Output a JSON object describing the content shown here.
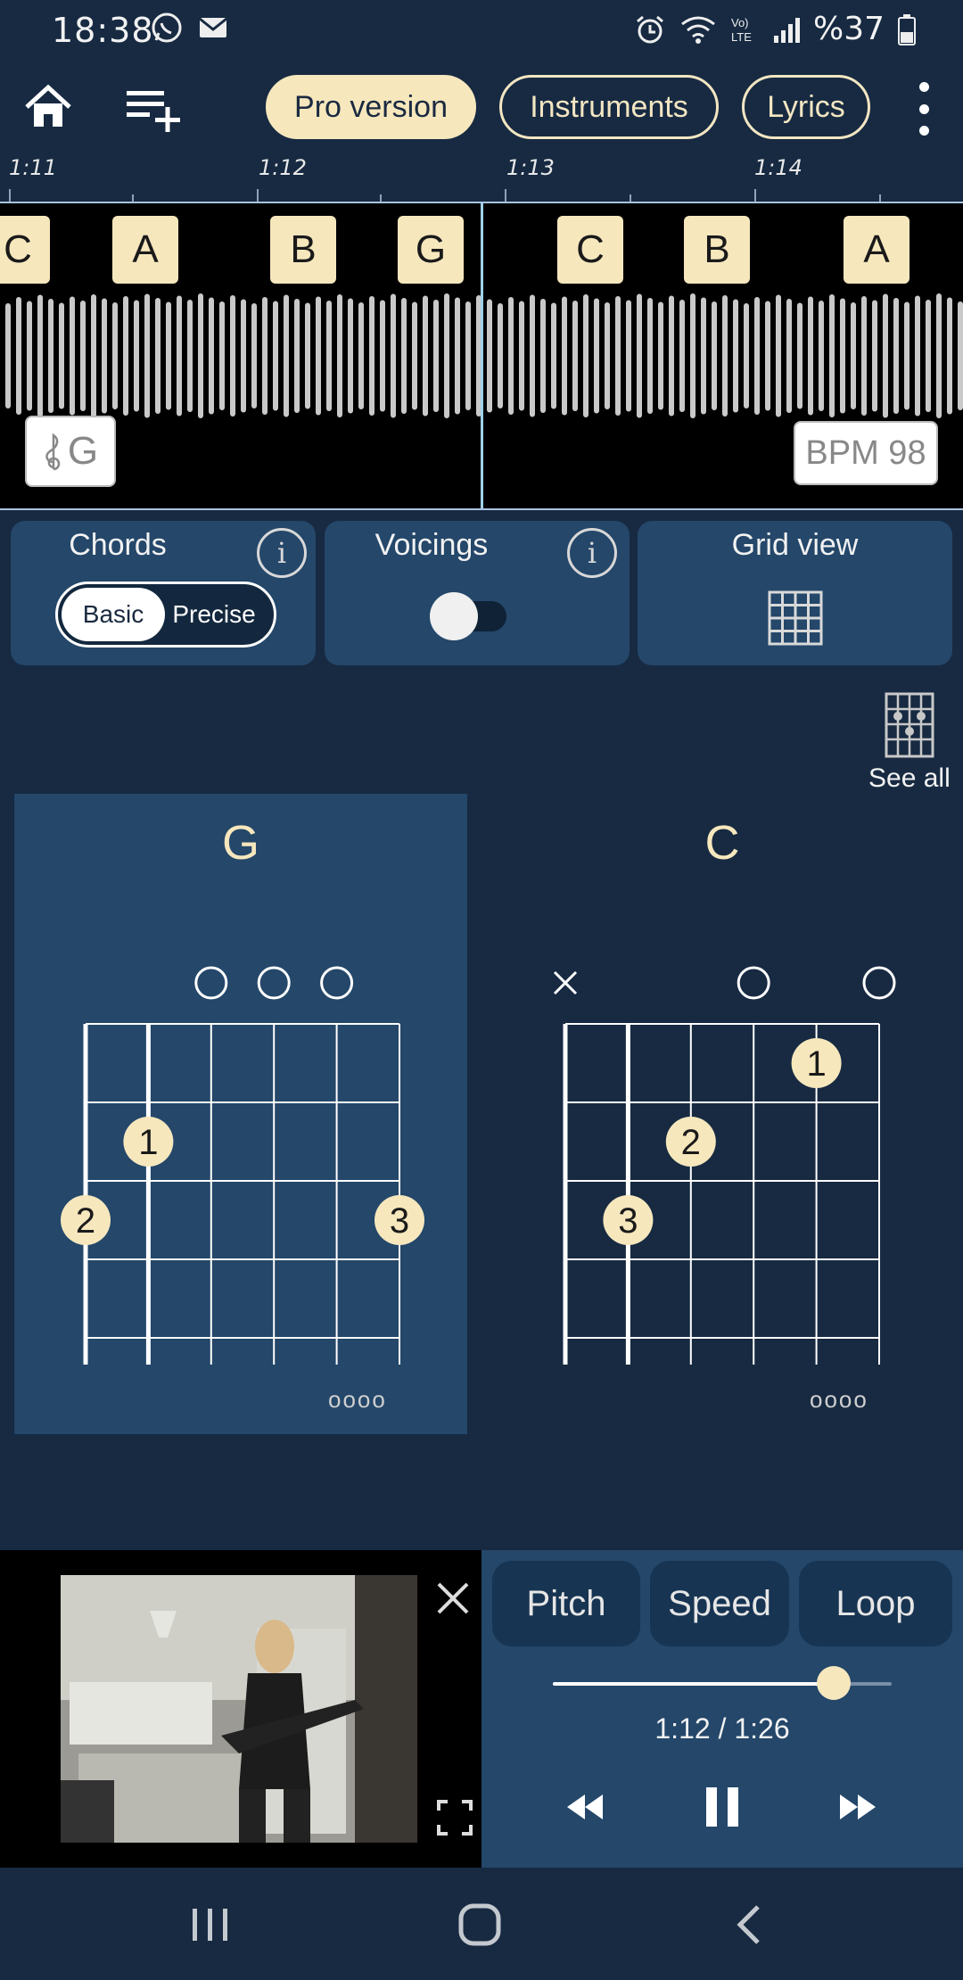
{
  "status_bar": {
    "time": "18:38",
    "battery": "%37"
  },
  "toolbar": {
    "pro_label": "Pro version",
    "instruments_label": "Instruments",
    "lyrics_label": "Lyrics"
  },
  "timeline": {
    "ticks": [
      "1:11",
      "1:12",
      "1:13",
      "1:14"
    ]
  },
  "waveform": {
    "chords": [
      "C",
      "A",
      "B",
      "G",
      "C",
      "B",
      "A"
    ],
    "key": "G",
    "bpm": "BPM 98"
  },
  "controls": {
    "chords_title": "Chords",
    "mode_basic": "Basic",
    "mode_precise": "Precise",
    "voicings_title": "Voicings",
    "voicings_on": false,
    "grid_title": "Grid view",
    "info_glyph": "i"
  },
  "see_all_label": "See all",
  "chord_diagrams": [
    {
      "name": "G",
      "open_strings": [
        "",
        "",
        "o",
        "o",
        "o",
        ""
      ],
      "fingers": [
        {
          "string": 2,
          "fret": 2,
          "finger": "1"
        },
        {
          "string": 1,
          "fret": 3,
          "finger": "2"
        },
        {
          "string": 6,
          "fret": 3,
          "finger": "3"
        }
      ],
      "more": "oooo"
    },
    {
      "name": "C",
      "open_strings": [
        "x",
        "",
        "",
        "o",
        "",
        "o"
      ],
      "fingers": [
        {
          "string": 5,
          "fret": 1,
          "finger": "1"
        },
        {
          "string": 3,
          "fret": 2,
          "finger": "2"
        },
        {
          "string": 2,
          "fret": 3,
          "finger": "3"
        }
      ],
      "more": "oooo"
    }
  ],
  "player": {
    "pitch_label": "Pitch",
    "speed_label": "Speed",
    "loop_label": "Loop",
    "progress_fraction": 0.83,
    "time": "1:12 / 1:26"
  },
  "colors": {
    "accent": "#f6e7bd",
    "panel": "#24476a",
    "background": "#172a42"
  }
}
